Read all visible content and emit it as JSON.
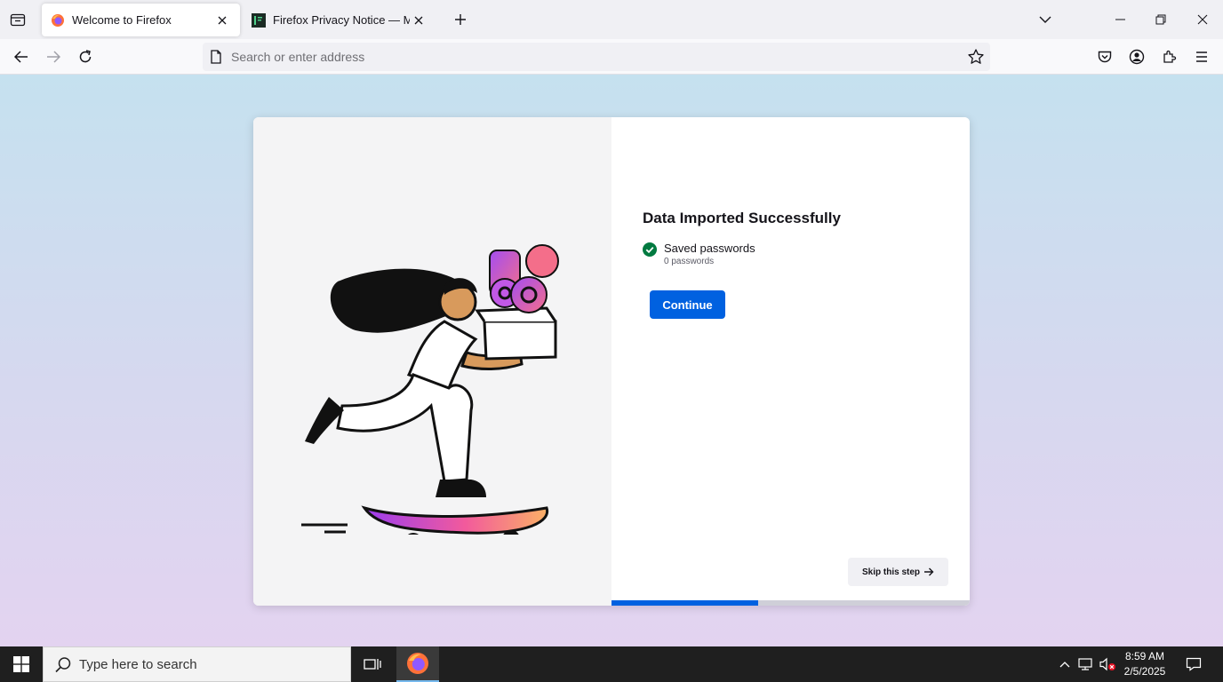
{
  "tabs": [
    {
      "title": "Welcome to Firefox",
      "active": true
    },
    {
      "title": "Firefox Privacy Notice — Mozilla",
      "active": false
    }
  ],
  "urlbar": {
    "placeholder": "Search or enter address",
    "value": ""
  },
  "onboarding": {
    "heading": "Data Imported Successfully",
    "items": [
      {
        "name": "Saved passwords",
        "count": "0 passwords",
        "status": "success"
      }
    ],
    "continue_label": "Continue",
    "skip_label": "Skip this step",
    "progress": 0.41
  },
  "taskbar": {
    "search_placeholder": "Type here to search",
    "time": "8:59 AM",
    "date": "2/5/2025"
  },
  "colors": {
    "accent": "#0061e0",
    "success": "#017a40",
    "tabstrip": "#f0f0f4",
    "taskbar": "#1f1f1f"
  },
  "icons": [
    "tab-list-icon",
    "firefox-icon",
    "terminal-favicon-icon",
    "close-icon",
    "plus-icon",
    "chevron-down-icon",
    "minimize-icon",
    "restore-icon",
    "back-icon",
    "forward-icon",
    "reload-icon",
    "page-icon",
    "star-icon",
    "pocket-icon",
    "account-icon",
    "extensions-icon",
    "menu-icon",
    "check-circle-icon",
    "arrow-right-icon",
    "windows-logo-icon",
    "search-icon",
    "task-view-icon",
    "chevron-up-icon",
    "network-icon",
    "volume-muted-icon",
    "notification-icon"
  ]
}
